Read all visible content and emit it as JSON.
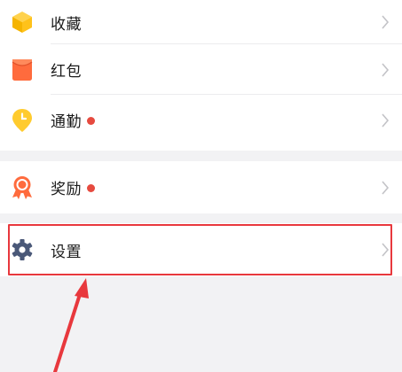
{
  "menu": {
    "group1": [
      {
        "label": "收藏",
        "icon": "cube-box-icon",
        "badge": false
      },
      {
        "label": "红包",
        "icon": "red-envelope-icon",
        "badge": false
      },
      {
        "label": "通勤",
        "icon": "clock-pin-icon",
        "badge": true
      }
    ],
    "group2": [
      {
        "label": "奖励",
        "icon": "award-medal-icon",
        "badge": true
      }
    ],
    "group3": [
      {
        "label": "设置",
        "icon": "gear-icon",
        "badge": false
      }
    ]
  },
  "annotation": {
    "highlight_target": "设置",
    "highlight_color": "#e8383d"
  },
  "colors": {
    "badge": "#e64a3f",
    "background": "#f2f2f4"
  }
}
